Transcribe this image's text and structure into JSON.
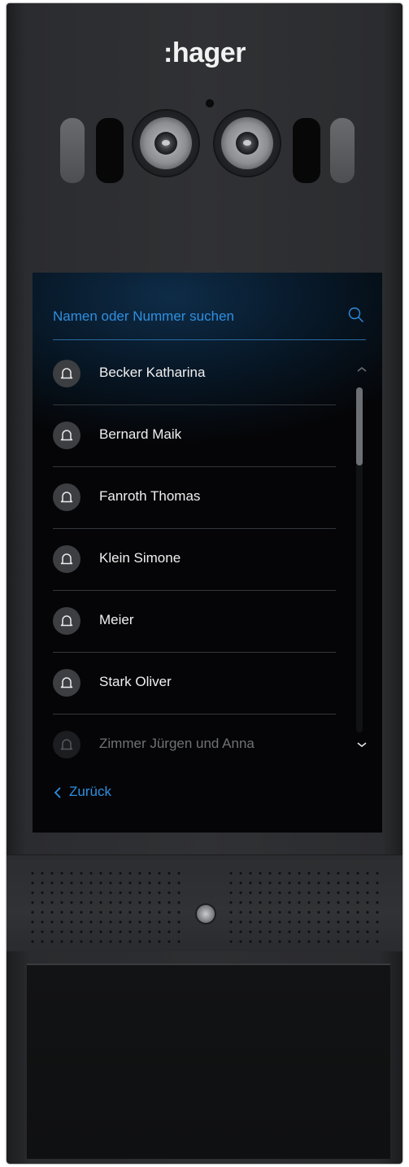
{
  "brand": {
    "logo": ":hager"
  },
  "search": {
    "placeholder": "Namen oder Nummer suchen",
    "icon": "search-icon"
  },
  "contacts": [
    {
      "name": "Becker Katharina",
      "icon": "bell-icon"
    },
    {
      "name": "Bernard Maik",
      "icon": "bell-icon"
    },
    {
      "name": "Fanroth Thomas",
      "icon": "bell-icon"
    },
    {
      "name": "Klein Simone",
      "icon": "bell-icon"
    },
    {
      "name": "Meier",
      "icon": "bell-icon"
    },
    {
      "name": "Stark Oliver",
      "icon": "bell-icon"
    },
    {
      "name": "Zimmer Jürgen und Anna",
      "icon": "bell-icon",
      "faded": true
    }
  ],
  "list": {
    "scroll_position": 0
  },
  "navigation": {
    "back_label": "Zurück"
  },
  "colors": {
    "accent": "#2f8fe0",
    "panel": "#2d2e31",
    "screen": "#050507",
    "text": "#f0f0f0"
  }
}
